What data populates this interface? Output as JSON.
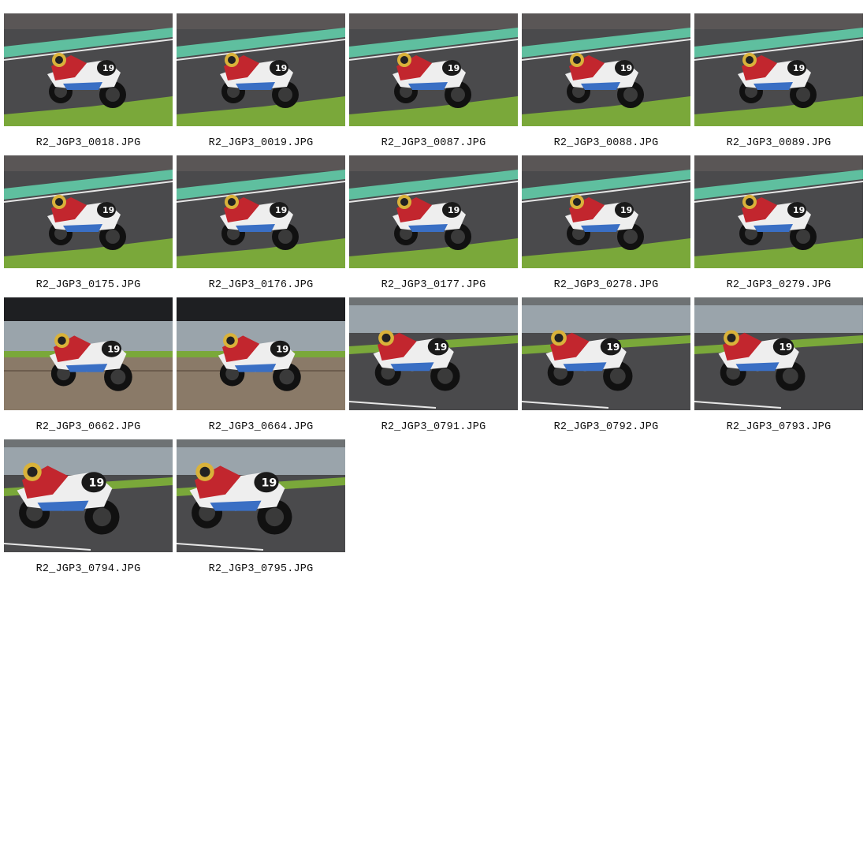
{
  "gallery": {
    "items": [
      {
        "filename": "R2_JGP3_0018.JPG",
        "scene": "track-curbs"
      },
      {
        "filename": "R2_JGP3_0019.JPG",
        "scene": "track-curbs"
      },
      {
        "filename": "R2_JGP3_0087.JPG",
        "scene": "track-curbs"
      },
      {
        "filename": "R2_JGP3_0088.JPG",
        "scene": "track-curbs"
      },
      {
        "filename": "R2_JGP3_0089.JPG",
        "scene": "track-curbs"
      },
      {
        "filename": "R2_JGP3_0175.JPG",
        "scene": "track-curbs"
      },
      {
        "filename": "R2_JGP3_0176.JPG",
        "scene": "track-curbs"
      },
      {
        "filename": "R2_JGP3_0177.JPG",
        "scene": "track-curbs"
      },
      {
        "filename": "R2_JGP3_0278.JPG",
        "scene": "track-curbs"
      },
      {
        "filename": "R2_JGP3_0279.JPG",
        "scene": "track-curbs"
      },
      {
        "filename": "R2_JGP3_0662.JPG",
        "scene": "gravel-side"
      },
      {
        "filename": "R2_JGP3_0664.JPG",
        "scene": "gravel-side"
      },
      {
        "filename": "R2_JGP3_0791.JPG",
        "scene": "barrier-lean"
      },
      {
        "filename": "R2_JGP3_0792.JPG",
        "scene": "barrier-lean"
      },
      {
        "filename": "R2_JGP3_0793.JPG",
        "scene": "barrier-lean"
      },
      {
        "filename": "R2_JGP3_0794.JPG",
        "scene": "barrier-close"
      },
      {
        "filename": "R2_JGP3_0795.JPG",
        "scene": "barrier-close"
      }
    ]
  },
  "colors": {
    "asphalt": "#4a4a4c",
    "curb": "#5fbf9f",
    "grass": "#7aa83a",
    "gravel": "#8a7a68",
    "barrier": "#9aa4ab",
    "rider_red": "#c2262e",
    "bike_white": "#eeeeee",
    "bike_blue": "#3a6fc4"
  }
}
